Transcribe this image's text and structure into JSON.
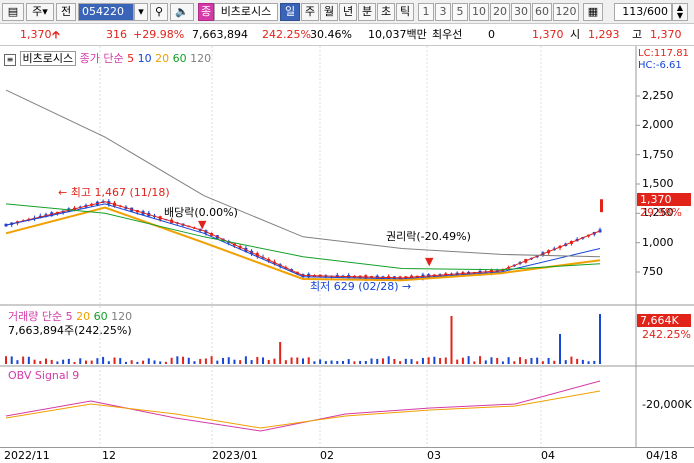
{
  "toolbar": {
    "code": "054220",
    "market": "주",
    "all": "전",
    "name_tag": "종",
    "stock_name": "비츠로시스",
    "periods": [
      "일",
      "주",
      "월",
      "년",
      "분",
      "초",
      "틱"
    ],
    "selected_period": "일",
    "intervals": [
      "1",
      "3",
      "5",
      "10",
      "20",
      "30",
      "60",
      "120"
    ],
    "page_counter": "113/600"
  },
  "quote": {
    "price": "1,370",
    "change": "316",
    "change_pct": "+29.98%",
    "volume": "7,663,894",
    "volume_ratio": "242.25%",
    "turnover_rate": "30.46%",
    "amount": "10,037백만",
    "best_ask_label": "최우선",
    "best_ask_qty": "0",
    "best_ask_price": "1,370",
    "open_label": "시",
    "open": "1,293",
    "high_label": "고",
    "high": "1,370"
  },
  "price_panel": {
    "stock_name": "비츠로시스",
    "ma_title": "종가 단순",
    "ma_periods": [
      "5",
      "10",
      "20",
      "60",
      "120"
    ],
    "lc": "LC:117.81",
    "hc": "HC:-6.61",
    "last_price_label": "1,370",
    "last_change_label": "29.98%",
    "annotations": {
      "high": "최고 1,467 (11/18)",
      "low": "최저 629 (02/28)",
      "dividend": "배당락(0.00%)",
      "rights": "권리락(-20.49%)"
    },
    "y_ticks": [
      "2,250",
      "2,000",
      "1,750",
      "1,500",
      "1,250",
      "1,000",
      "750"
    ]
  },
  "volume_panel": {
    "title": "거래량",
    "ma_title": "단순",
    "ma_periods": [
      "5",
      "20",
      "60",
      "120"
    ],
    "value": "7,663,894주(242.25%)",
    "last_label": "7,664K",
    "last_pct": "242.25%"
  },
  "obv_panel": {
    "title": "OBV",
    "signal": "Signal 9",
    "y_tick": "-20,000K"
  },
  "x_axis": [
    "2022/11",
    "12",
    "2023/01",
    "02",
    "03",
    "04",
    "04/18"
  ],
  "colors": {
    "up": "#e2231a",
    "down": "#1646d6",
    "ma5": "#e2231a",
    "ma10": "#1646d6",
    "ma20": "#f0a000",
    "ma60": "#14a028",
    "ma120": "#808080"
  },
  "chart_data": {
    "type": "line",
    "y_range": [
      600,
      2400
    ],
    "x": [
      "2022/11",
      "12",
      "2023/01",
      "02",
      "03",
      "04",
      "04/18"
    ],
    "series": [
      {
        "name": "5",
        "values": [
          1150,
          1350,
          1100,
          720,
          700,
          760,
          1100
        ]
      },
      {
        "name": "10",
        "values": [
          1150,
          1330,
          1080,
          710,
          690,
          750,
          950
        ]
      },
      {
        "name": "20",
        "values": [
          1080,
          1300,
          1000,
          690,
          680,
          740,
          850
        ]
      },
      {
        "name": "60",
        "values": [
          1330,
          1250,
          1050,
          880,
          780,
          770,
          820
        ]
      },
      {
        "name": "120",
        "values": [
          2300,
          1900,
          1400,
          1050,
          950,
          900,
          880
        ]
      }
    ]
  }
}
